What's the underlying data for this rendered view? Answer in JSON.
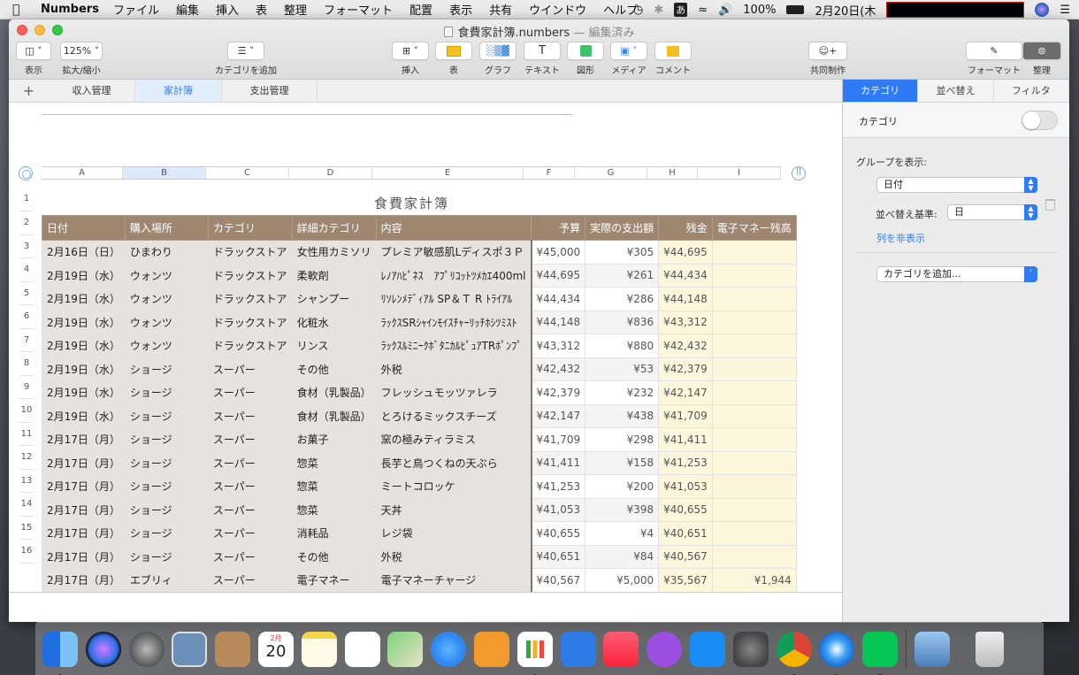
{
  "menubar": {
    "app": "Numbers",
    "items": [
      "ファイル",
      "編集",
      "挿入",
      "表",
      "整理",
      "フォーマット",
      "配置",
      "表示",
      "共有",
      "ウインドウ",
      "ヘルプ"
    ],
    "ime": "あ",
    "battery": "100%",
    "date": "2月20日(木"
  },
  "window": {
    "title": "食費家計簿.numbers",
    "title_suffix": "— 編集済み",
    "toolbar": {
      "view": "表示",
      "zoom_value": "125%",
      "zoom": "拡大/縮小",
      "add_category": "カテゴリを追加",
      "insert": "挿入",
      "table": "表",
      "chart": "グラフ",
      "text": "テキスト",
      "shape": "図形",
      "media": "メディア",
      "comment": "コメント",
      "collaborate": "共同制作",
      "format": "フォーマット",
      "organize": "整理"
    }
  },
  "sheets": [
    "収入管理",
    "家計簿",
    "支出管理"
  ],
  "table": {
    "title": "食費家計簿",
    "col_letters": [
      "A",
      "B",
      "C",
      "D",
      "E",
      "F",
      "G",
      "H",
      "I"
    ],
    "headers": [
      "日付",
      "購入場所",
      "カテゴリ",
      "詳細カテゴリ",
      "内容",
      "予算",
      "実際の支出額",
      "残金",
      "電子マネー残高"
    ],
    "rows": [
      [
        "2月16日（日）",
        "ひまわり",
        "ドラックストア",
        "女性用カミソリ",
        "プレミア敏感肌Lディスポ３Ｐ",
        "¥45,000",
        "¥305",
        "¥44,695",
        ""
      ],
      [
        "2月19日（水）",
        "ウォンツ",
        "ドラックストア",
        "柔軟剤",
        "ﾚﾉｱﾊﾋﾟﾈｽ　ｱﾌﾟﾘｺｯﾄﾂﾒｶｴ400ml",
        "¥44,695",
        "¥261",
        "¥44,434",
        ""
      ],
      [
        "2月19日（水）",
        "ウォンツ",
        "ドラックストア",
        "シャンプー",
        "ﾘｿﾚﾝﾒﾃﾞｨｱﾙ SP＆Ｔ R ﾄﾗｲｱﾙ",
        "¥44,434",
        "¥286",
        "¥44,148",
        ""
      ],
      [
        "2月19日（水）",
        "ウォンツ",
        "ドラックストア",
        "化粧水",
        "ﾗｯｸｽSRｼｬｲﾝﾓｲｽﾁｬｰﾘｯﾁﾎｼﾂﾐｽﾄ",
        "¥44,148",
        "¥836",
        "¥43,312",
        ""
      ],
      [
        "2月19日（水）",
        "ウォンツ",
        "ドラックストア",
        "リンス",
        "ﾗｯｸｽﾙﾐﾆｰｸﾎﾞﾀﾆｶﾙﾋﾟｭｱTRﾎﾟﾝﾌﾟ",
        "¥43,312",
        "¥880",
        "¥42,432",
        ""
      ],
      [
        "2月19日（水）",
        "ショージ",
        "スーパー",
        "その他",
        "外税",
        "¥42,432",
        "¥53",
        "¥42,379",
        ""
      ],
      [
        "2月19日（水）",
        "ショージ",
        "スーパー",
        "食材（乳製品）",
        "フレッシュモッツァレラ",
        "¥42,379",
        "¥232",
        "¥42,147",
        ""
      ],
      [
        "2月19日（水）",
        "ショージ",
        "スーパー",
        "食材（乳製品）",
        "とろけるミックスチーズ",
        "¥42,147",
        "¥438",
        "¥41,709",
        ""
      ],
      [
        "2月17日（月）",
        "ショージ",
        "スーパー",
        "お菓子",
        "窯の極みティラミス",
        "¥41,709",
        "¥298",
        "¥41,411",
        ""
      ],
      [
        "2月17日（月）",
        "ショージ",
        "スーパー",
        "惣菜",
        "長芋と鳥つくねの天ぷら",
        "¥41,411",
        "¥158",
        "¥41,253",
        ""
      ],
      [
        "2月17日（月）",
        "ショージ",
        "スーパー",
        "惣菜",
        "ミートコロッケ",
        "¥41,253",
        "¥200",
        "¥41,053",
        ""
      ],
      [
        "2月17日（月）",
        "ショージ",
        "スーパー",
        "惣菜",
        "天丼",
        "¥41,053",
        "¥398",
        "¥40,655",
        ""
      ],
      [
        "2月17日（月）",
        "ショージ",
        "スーパー",
        "消耗品",
        "レジ袋",
        "¥40,655",
        "¥4",
        "¥40,651",
        ""
      ],
      [
        "2月17日（月）",
        "ショージ",
        "スーパー",
        "その他",
        "外税",
        "¥40,651",
        "¥84",
        "¥40,567",
        ""
      ],
      [
        "2月17日（月）",
        "エブリィ",
        "スーパー",
        "電子マネー",
        "電子マネーチャージ",
        "¥40,567",
        "¥5,000",
        "¥35,567",
        "¥1,944"
      ]
    ]
  },
  "sidebar": {
    "tabs": [
      "カテゴリ",
      "並べ替え",
      "フィルタ"
    ],
    "category_label": "カテゴリ",
    "group_by_label": "グループを表示:",
    "group_by_value": "日付",
    "sort_label": "並べ替え基準:",
    "sort_value": "日",
    "hide_column": "列を非表示",
    "add_category": "カテゴリを追加..."
  },
  "dock": [
    "Finder",
    "Siri",
    "Launchpad",
    "Preview",
    "Contacts",
    "Calendar",
    "Notes",
    "Reminders",
    "Maps",
    "Messages",
    "Pages",
    "Numbers",
    "Keynote",
    "Music",
    "Podcasts",
    "App Store",
    "System Preferences",
    "Chrome",
    "Safari",
    "LINE",
    "Preview Photos",
    "Trash"
  ],
  "dock_calendar": {
    "month": "2月",
    "day": "20"
  }
}
